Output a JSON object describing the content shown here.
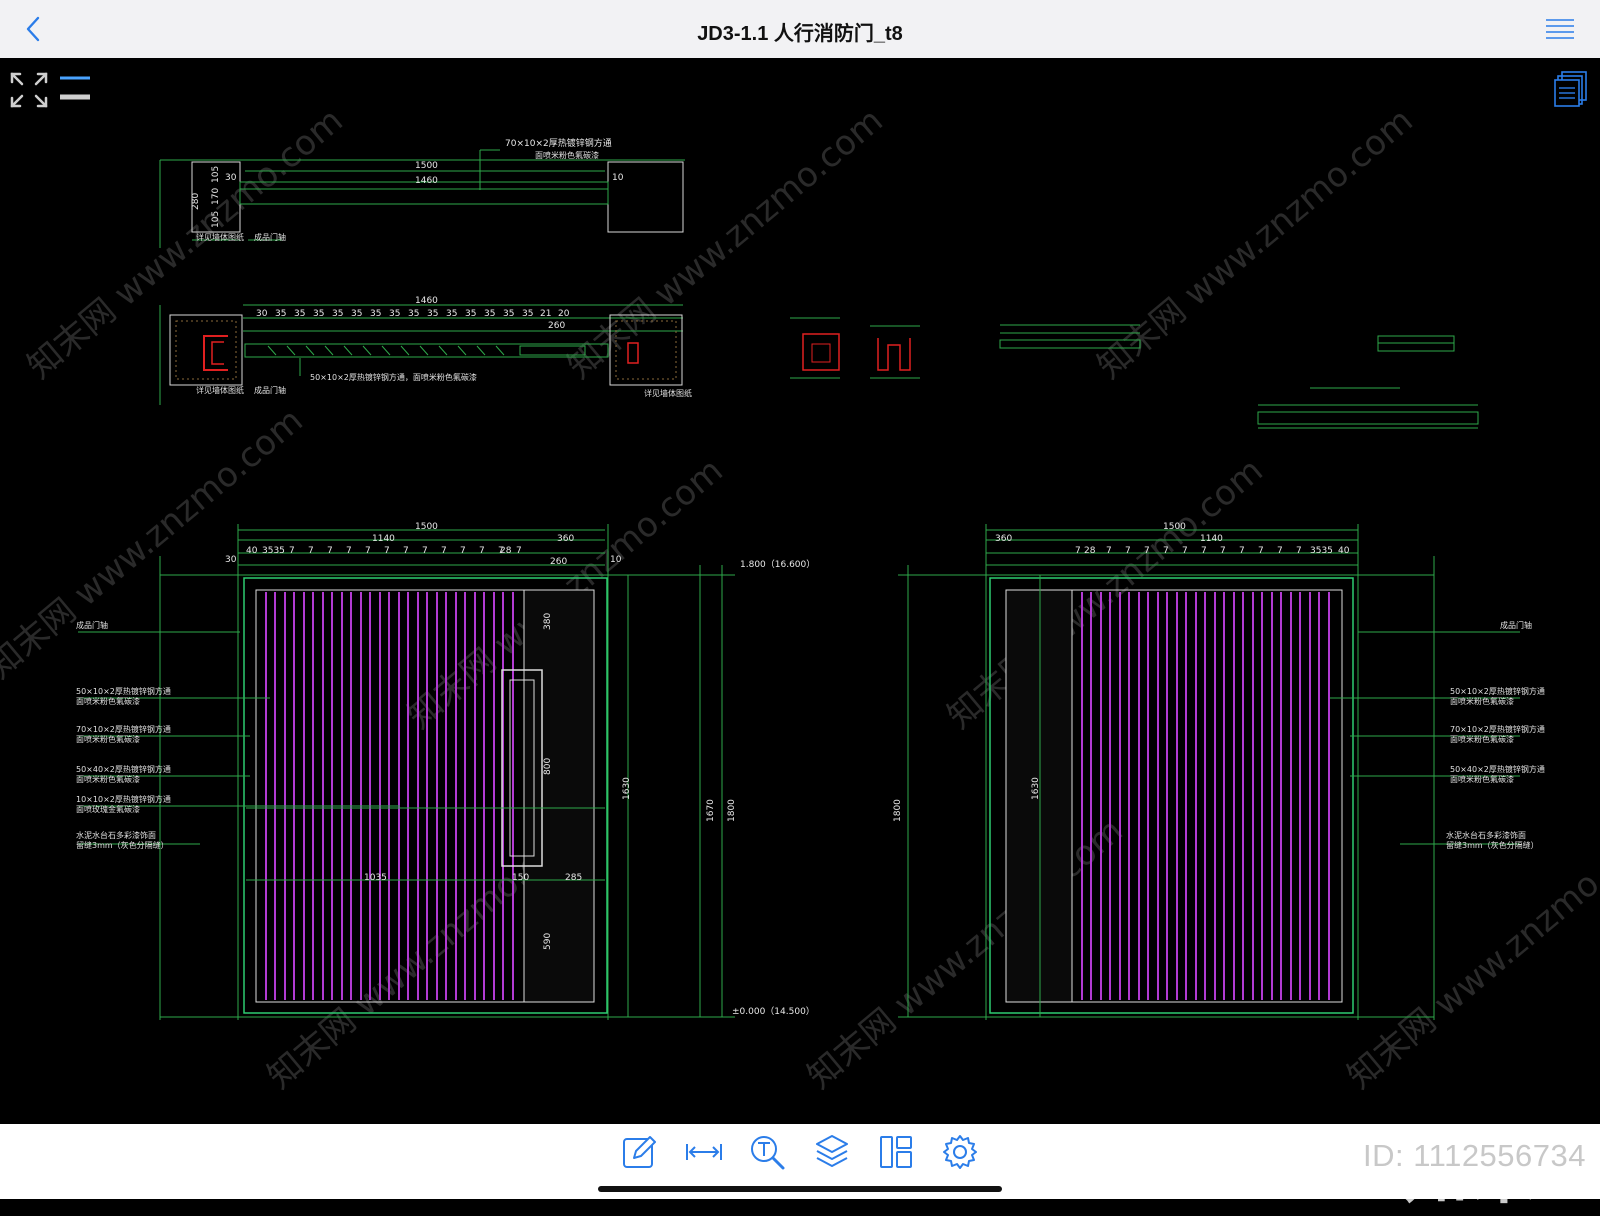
{
  "header": {
    "title": "JD3-1.1 人行消防门_t8"
  },
  "icons": {
    "back": "chevron-left-icon",
    "menu": "list-menu-icon",
    "expand": "expand-arrows-icon",
    "collapse": "collapse-lines-icon",
    "layouts": "sheets-icon"
  },
  "toolbar": [
    "edit-icon",
    "measure-icon",
    "text-search-icon",
    "layers-icon",
    "layout-icon",
    "settings-icon"
  ],
  "colors": {
    "accent": "#2b7de9",
    "drawing_line": "#2ea84a",
    "door_fill": "#b23bd2",
    "background": "#000000"
  },
  "watermark": {
    "logo": "知末",
    "id": "ID: 1112556734",
    "tile": "知末网 www.znzmo.com"
  },
  "drawing": {
    "top_plan": {
      "w1": "1500",
      "w2": "1460",
      "note": "70×10×2厚热镀锌钢方通",
      "note2": "面喷米粉色氟碳漆",
      "left1": "详见墙体图纸",
      "left2": "成品门轴",
      "h1": "280",
      "h2": "105",
      "h3": "170",
      "h4": "105",
      "d30": "30",
      "d10": "10"
    },
    "section_plan": {
      "w": "1460",
      "seq": [
        "30",
        "35",
        "35",
        "35",
        "35",
        "35",
        "35",
        "35",
        "35",
        "35",
        "35",
        "35",
        "35",
        "35",
        "35",
        "21",
        "20"
      ],
      "sub": "260",
      "note": "50×10×2厚热镀锌钢方通，面喷米粉色氟碳漆",
      "left1": "详见墙体图纸",
      "left2": "成品门轴",
      "right1": "详见墙体图纸"
    },
    "elev_left": {
      "w_total": "1500",
      "w_leaf": "1140",
      "w_side": "360",
      "top_seq": [
        "40",
        "3535",
        "7",
        "7",
        "7",
        "7",
        "7",
        "7",
        "7",
        "7",
        "7",
        "7",
        "7",
        "7",
        "28",
        "7"
      ],
      "d30": "30",
      "d260": "260",
      "d10": "10",
      "h1630": "1630",
      "h1670": "1670",
      "h1800": "1800",
      "h380": "380",
      "h800": "800",
      "h590": "590",
      "w1035": "1035",
      "w150": "150",
      "w285": "285",
      "lv_top": "1.800（16.600）",
      "lv_bot": "±0.000（14.500）",
      "labels": [
        "成品门轴",
        "50×10×2厚热镀锌钢方通",
        "面喷米粉色氟碳漆",
        "70×10×2厚热镀锌钢方通",
        "面喷米粉色氟碳漆",
        "50×40×2厚热镀锌钢方通",
        "面喷米粉色氟碳漆",
        "10×10×2厚热镀锌钢方通",
        "面喷玫瑰金氟碳漆",
        "水泥水台石多彩漆饰面",
        "留缝3mm（灰色分隔缝）"
      ]
    },
    "elev_right": {
      "w_total": "1500",
      "w_leaf": "1140",
      "w_side": "360",
      "top_seq": [
        "7",
        "28",
        "7",
        "7",
        "7",
        "7",
        "7",
        "7",
        "7",
        "7",
        "7",
        "7",
        "7",
        "3535",
        "40"
      ],
      "h1630": "1630",
      "h1800": "1800",
      "labels": [
        "成品门轴",
        "50×10×2厚热镀锌钢方通",
        "面喷米粉色氟碳漆",
        "70×10×2厚热镀锌钢方通",
        "面喷米粉色氟碳漆",
        "50×40×2厚热镀锌钢方通",
        "面喷米粉色氟碳漆",
        "水泥水台石多彩漆饰面",
        "留缝3mm（灰色分隔缝）"
      ]
    }
  }
}
